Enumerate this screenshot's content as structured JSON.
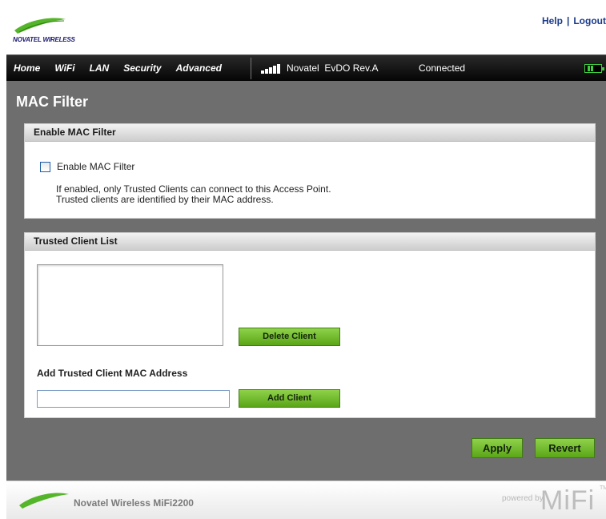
{
  "header": {
    "logo_text": "NOVATEL WIRELESS",
    "help_label": "Help",
    "separator": "|",
    "logout_label": "Logout"
  },
  "nav": {
    "items": [
      {
        "label": "Home"
      },
      {
        "label": "WiFi"
      },
      {
        "label": "LAN"
      },
      {
        "label": "Security"
      },
      {
        "label": "Advanced"
      }
    ],
    "carrier": "Novatel  EvDO Rev.A",
    "status": "Connected",
    "signal_bars": 5
  },
  "main": {
    "title": "MAC Filter",
    "enable_panel": {
      "header": "Enable MAC Filter",
      "checkbox_label": "Enable MAC Filter",
      "checked": false,
      "help_line1": "If enabled, only Trusted Clients can connect to this Access Point.",
      "help_line2": "Trusted clients are identified by their MAC address."
    },
    "trusted_panel": {
      "header": "Trusted Client List",
      "clients": [],
      "delete_label": "Delete Client",
      "add_label": "Add Trusted Client MAC Address",
      "mac_value": "",
      "add_button_label": "Add Client"
    },
    "apply_label": "Apply",
    "revert_label": "Revert"
  },
  "footer": {
    "product": "Novatel Wireless MiFi2200",
    "powered_by": "powered by",
    "brand": "MiFi",
    "tm": "TM"
  },
  "colors": {
    "accent_green": "#6cbf2a",
    "nav_bg": "#0a0a0a",
    "main_bg": "#6e6e6e",
    "link_blue": "#1a3a8a"
  }
}
